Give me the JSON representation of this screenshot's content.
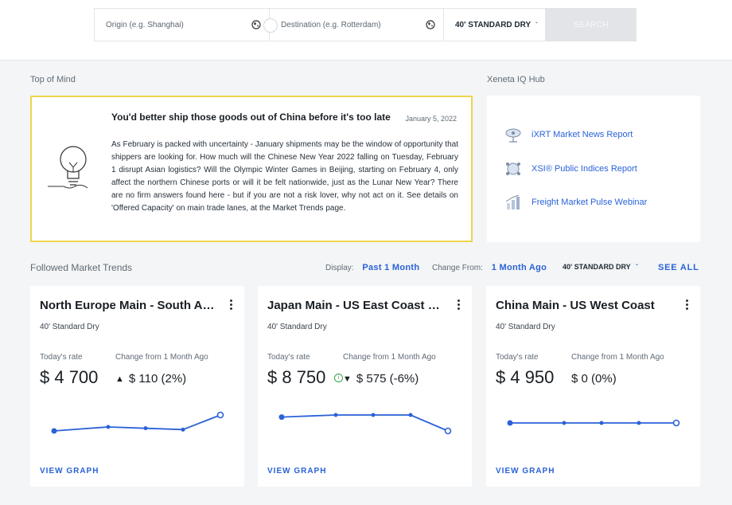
{
  "search": {
    "origin_placeholder": "Origin (e.g. Shanghai)",
    "destination_placeholder": "Destination (e.g. Rotterdam)",
    "equipment": "40' STANDARD DRY",
    "search_label": "SEARCH"
  },
  "top_of_mind": {
    "section_label": "Top of Mind",
    "title": "You'd better ship those goods out of China before it's too late",
    "date": "January 5, 2022",
    "body": "As February is packed with uncertainty - January shipments may be the window of opportunity that shippers are looking for. How much will the Chinese New Year 2022 falling on Tuesday, February 1 disrupt Asian logistics? Will the Olympic Winter Games in Beijing, starting on February 4, only affect the northern Chinese ports or will it be felt nationwide, just as the Lunar New Year? There are no firm answers found here - but if you are not a risk lover, why not act on it. See details on 'Offered Capacity' on main trade lanes, at the Market Trends page."
  },
  "hub": {
    "section_label": "Xeneta IQ Hub",
    "items": [
      {
        "label": "iXRT Market News Report",
        "icon": "satellite-icon"
      },
      {
        "label": "XSI® Public Indices Report",
        "icon": "globe-network-icon"
      },
      {
        "label": "Freight Market Pulse Webinar",
        "icon": "bar-chart-icon"
      }
    ]
  },
  "trends": {
    "section_label": "Followed Market Trends",
    "display_label": "Display:",
    "display_value": "Past 1 Month",
    "change_label": "Change From:",
    "change_value": "1 Month Ago",
    "equipment": "40' STANDARD DRY",
    "see_all": "SEE ALL",
    "cards": [
      {
        "title": "North Europe Main - South America East Coast",
        "subtitle": "40' Standard Dry",
        "rate_label": "Today's rate",
        "change_label": "Change from 1 Month Ago",
        "rate": "$ 4 700",
        "change": "$ 110 (2%)",
        "direction": "up",
        "trend": [
          4580,
          4610,
          4600,
          4590,
          4700
        ],
        "view_graph": "VIEW GRAPH"
      },
      {
        "title": "Japan Main - US East Coast Main",
        "subtitle": "40' Standard Dry",
        "rate_label": "Today's rate",
        "change_label": "Change from 1 Month Ago",
        "rate": "$ 8 750",
        "change": "$ 575 (-6%)",
        "direction": "down",
        "trend": [
          9250,
          9325,
          9325,
          9325,
          8750
        ],
        "view_graph": "VIEW GRAPH"
      },
      {
        "title": "China Main - US West Coast",
        "subtitle": "40' Standard Dry",
        "rate_label": "Today's rate",
        "change_label": "Change from 1 Month Ago",
        "rate": "$ 4 950",
        "change": "$ 0 (0%)",
        "direction": "flat",
        "trend": [
          4950,
          4950,
          4950,
          4950,
          4950
        ],
        "view_graph": "VIEW GRAPH"
      }
    ]
  },
  "colors": {
    "accent": "#2a62d8",
    "highlight_border": "#f0d44c",
    "positive": "#3aa34a"
  }
}
